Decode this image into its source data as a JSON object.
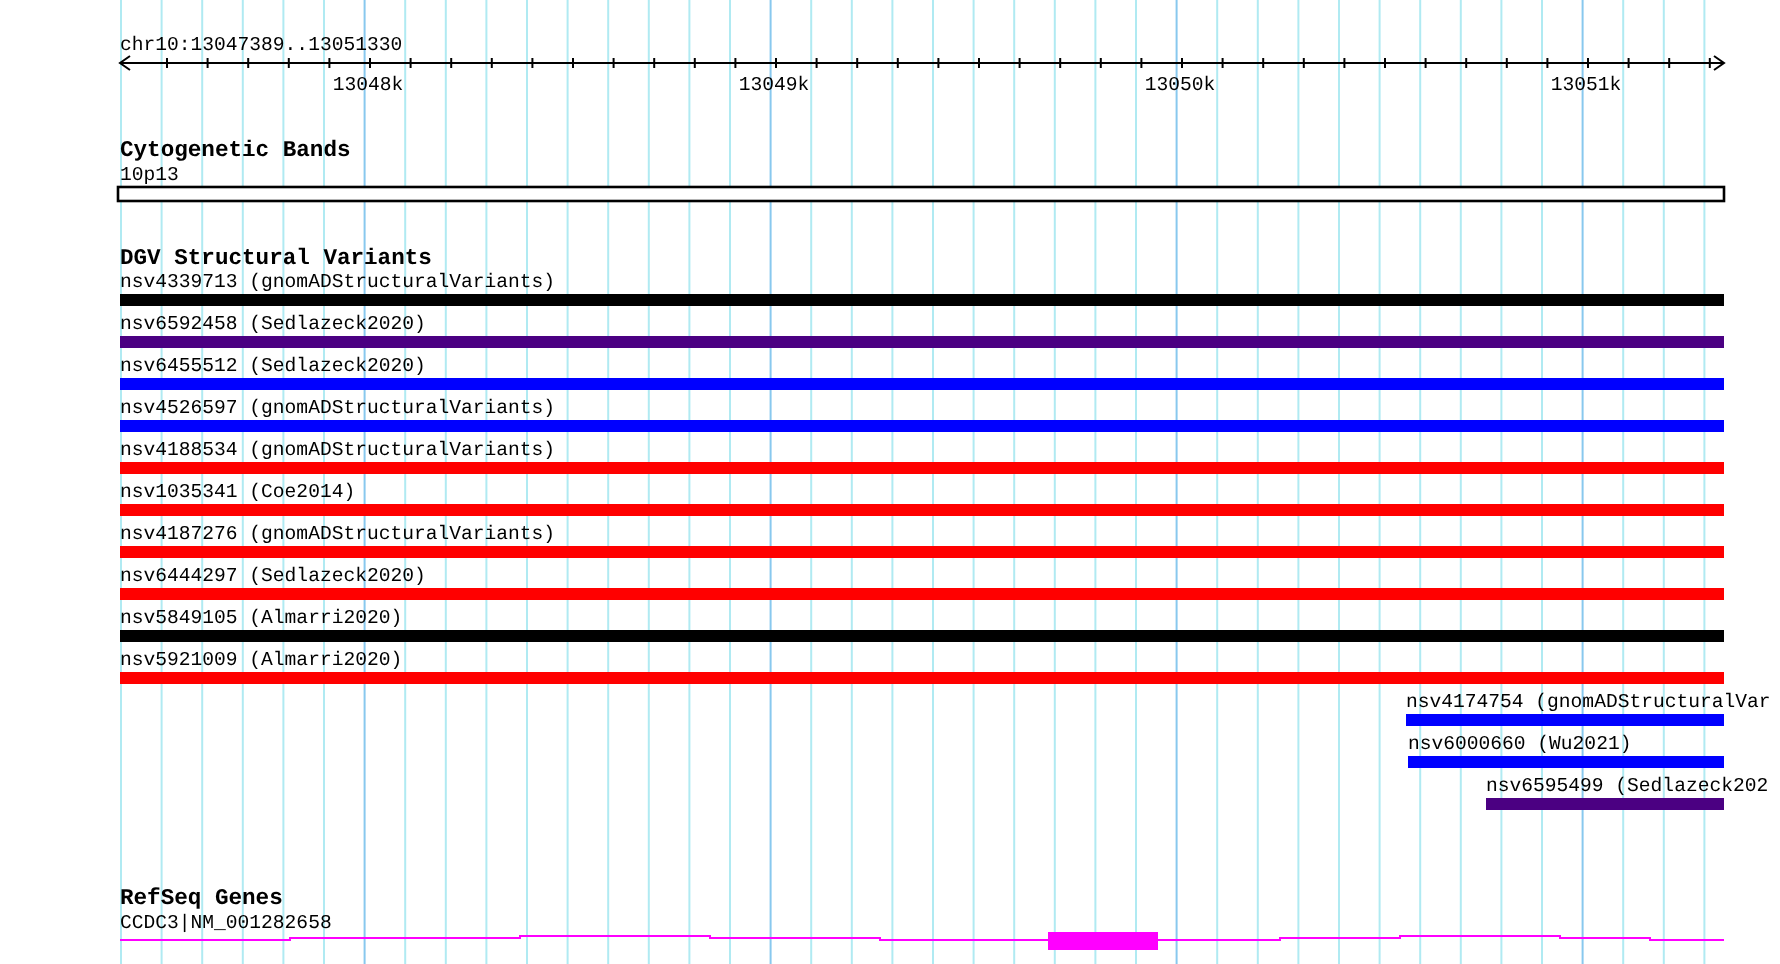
{
  "ruler": {
    "title": "chr10:13047389..13051330",
    "ticks": [
      "13048k",
      "13049k",
      "13050k",
      "13051k"
    ]
  },
  "tracks": [
    {
      "kind": "band",
      "title": "Cytogenetic Bands",
      "label": "10p13"
    },
    {
      "kind": "variants",
      "title": "DGV Structural Variants",
      "features": [
        {
          "label": "nsv4339713 (gnomADStructuralVariants)",
          "color": "#000000",
          "kind": "full"
        },
        {
          "label": "nsv6592458 (Sedlazeck2020)",
          "color": "#4b0082",
          "kind": "full"
        },
        {
          "label": "nsv6455512 (Sedlazeck2020)",
          "color": "#0000ff",
          "kind": "full"
        },
        {
          "label": "nsv4526597 (gnomADStructuralVariants)",
          "color": "#0000ff",
          "kind": "full"
        },
        {
          "label": "nsv4188534 (gnomADStructuralVariants)",
          "color": "#ff0000",
          "kind": "full"
        },
        {
          "label": "nsv1035341 (Coe2014)",
          "color": "#ff0000",
          "kind": "full"
        },
        {
          "label": "nsv4187276 (gnomADStructuralVariants)",
          "color": "#ff0000",
          "kind": "full"
        },
        {
          "label": "nsv6444297 (Sedlazeck2020)",
          "color": "#ff0000",
          "kind": "full"
        },
        {
          "label": "nsv5849105 (Almarri2020)",
          "color": "#000000",
          "kind": "full"
        },
        {
          "label": "nsv5921009 (Almarri2020)",
          "color": "#ff0000",
          "kind": "full"
        },
        {
          "label": "nsv4174754 (gnomADStructuralVar",
          "color": "#0000ff",
          "kind": "partial"
        },
        {
          "label": "nsv6000660 (Wu2021)",
          "color": "#0000ff",
          "kind": "partial"
        },
        {
          "label": "nsv6595499 (Sedlazeck202",
          "color": "#4b0082",
          "kind": "partial"
        }
      ]
    },
    {
      "kind": "gene",
      "title": "RefSeq Genes",
      "label": "CCDC3|NM_001282658"
    }
  ]
}
